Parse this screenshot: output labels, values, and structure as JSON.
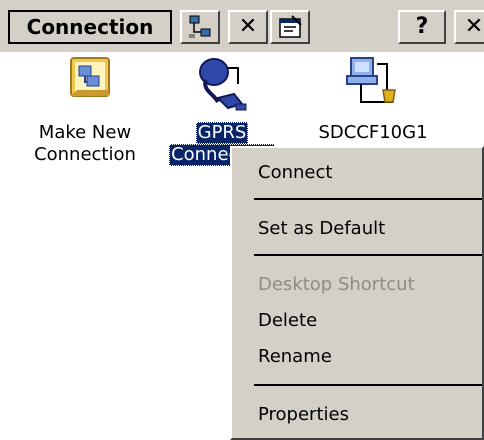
{
  "toolbar": {
    "title": "Connection",
    "buttons": [
      {
        "name": "network-connections-icon"
      },
      {
        "name": "delete-icon",
        "glyph": "✕"
      },
      {
        "name": "properties-icon"
      },
      {
        "name": "help-icon",
        "glyph": "?"
      },
      {
        "name": "close-icon",
        "glyph": "✕"
      }
    ]
  },
  "desktop": {
    "items": [
      {
        "label_line1": "Make New",
        "label_line2": "Connection",
        "icon": "make-new-connection-icon"
      },
      {
        "label_line1": "GPRS",
        "label_line2": "Connection",
        "icon": "dialup-connection-icon",
        "selected": true
      },
      {
        "label_line1": "SDCCF10G1",
        "label_line2": "",
        "icon": "network-connection-icon"
      }
    ]
  },
  "context_menu": {
    "items": [
      {
        "label": "Connect",
        "enabled": true
      },
      {
        "label": "Set as Default",
        "enabled": true
      },
      {
        "label": "Desktop Shortcut",
        "enabled": false
      },
      {
        "label": "Delete",
        "enabled": true
      },
      {
        "label": "Rename",
        "enabled": true
      },
      {
        "label": "Properties",
        "enabled": true
      }
    ]
  },
  "colors": {
    "chrome": "#d4d0c8",
    "selection": "#0a246a",
    "disabled_text": "#8e8a84"
  }
}
